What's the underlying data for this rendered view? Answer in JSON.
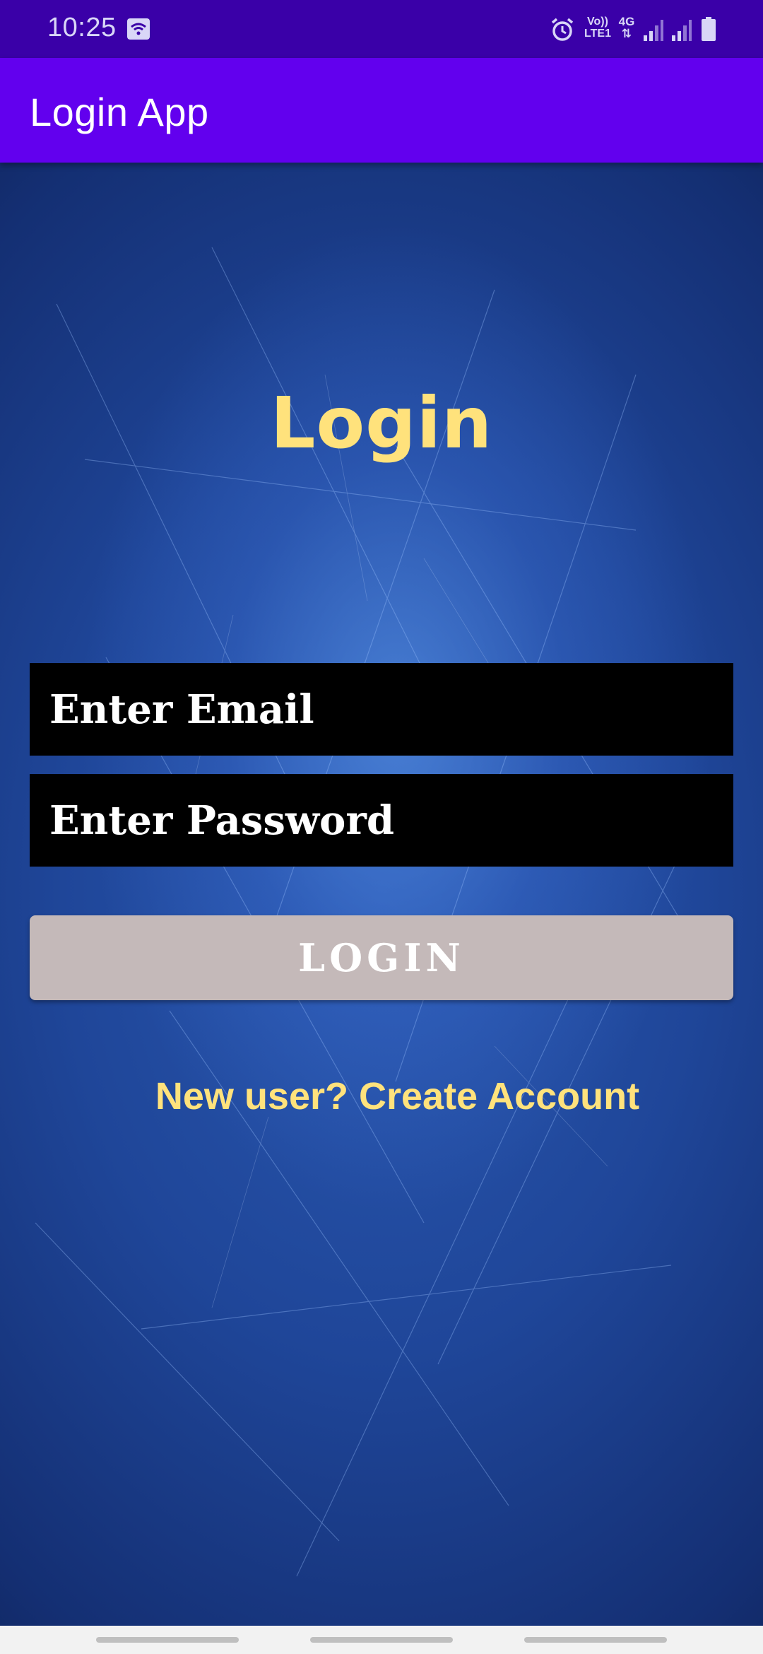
{
  "status_bar": {
    "time": "10:25",
    "icons": [
      "wifi-icon",
      "alarm-icon",
      "volte-icon",
      "4g-icon",
      "signal-icon",
      "signal-icon",
      "battery-icon"
    ],
    "volte_label_top": "Vo))",
    "volte_label_bottom": "LTE1",
    "network_label": "4G"
  },
  "app_bar": {
    "title": "Login App",
    "color": "#6200ee"
  },
  "login": {
    "heading": "Login",
    "email_placeholder": "Enter Email",
    "password_placeholder": "Enter Password",
    "button_label": "LOGIN",
    "create_account_link": "New user? Create Account"
  },
  "colors": {
    "status_bar": "#3a00a8",
    "accent_text": "#ffe27c",
    "field_background": "#000000",
    "button_background": "#c4b9b9"
  }
}
